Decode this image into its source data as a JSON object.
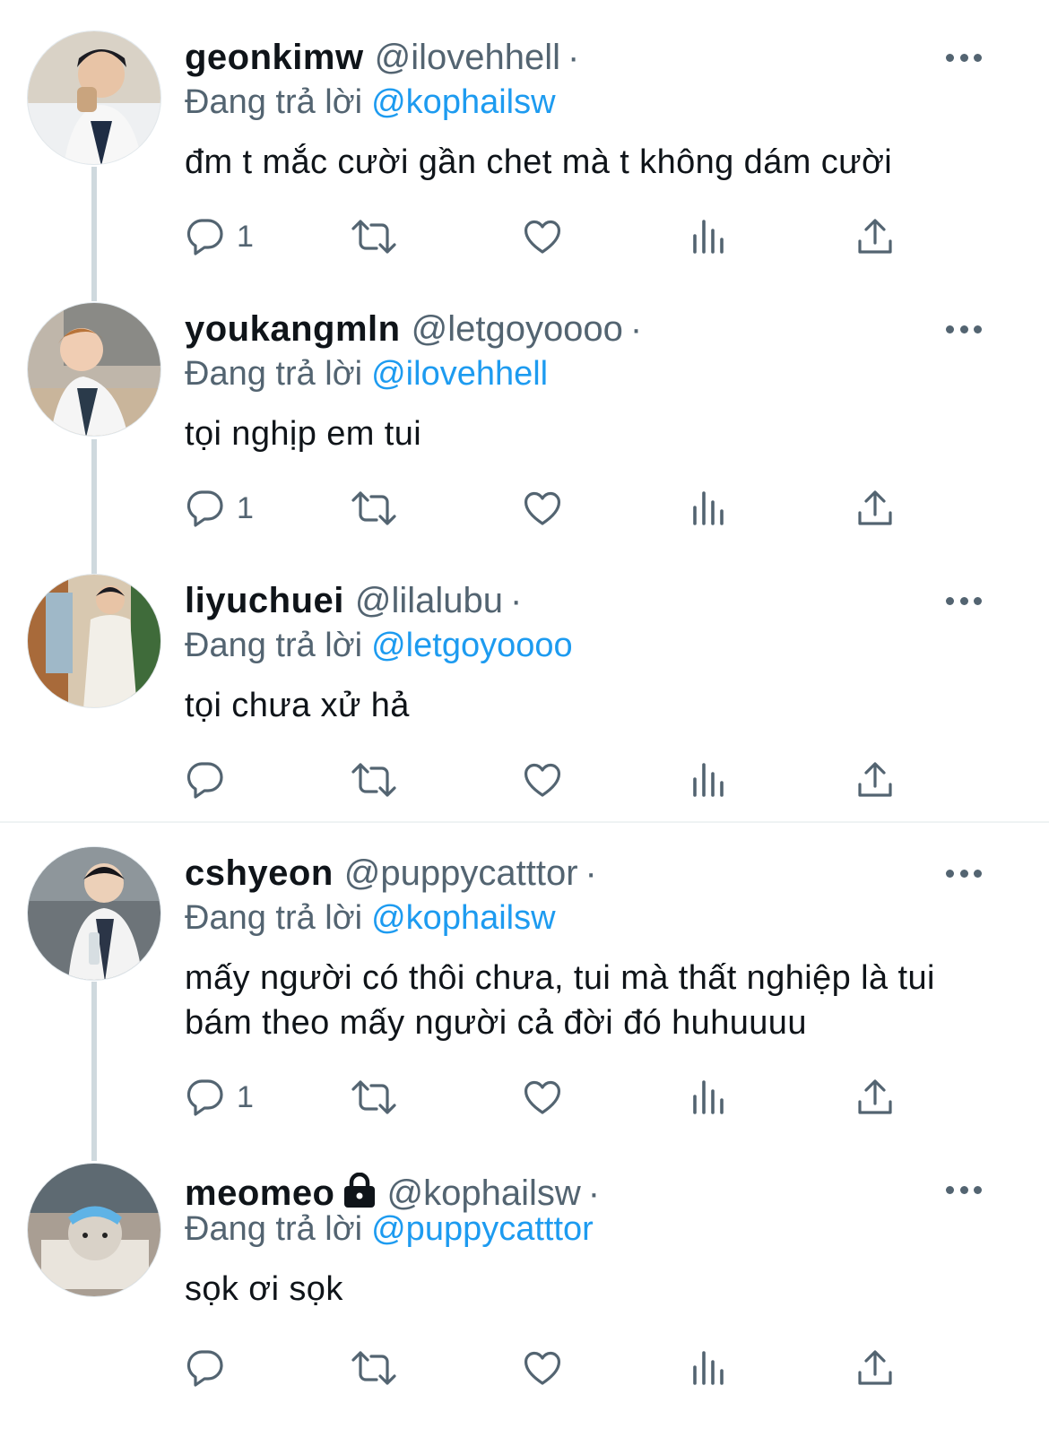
{
  "tweets": [
    {
      "name": "geonkimw",
      "handle": "@ilovehhell",
      "separator": "·",
      "reply_prefix": "Đang trả lời",
      "reply_to": "@kophailsw",
      "text": "đm t mắc cười gần chet mà t không dám cười",
      "reply_count": "1",
      "locked": false
    },
    {
      "name": "youkangmln",
      "handle": "@letgoyoooo",
      "separator": "·",
      "reply_prefix": "Đang trả lời",
      "reply_to": "@ilovehhell",
      "text": "tọi nghịp em tui",
      "reply_count": "1",
      "locked": false
    },
    {
      "name": "liyuchuei",
      "handle": "@lilalubu",
      "separator": "·",
      "reply_prefix": "Đang trả lời",
      "reply_to": "@letgoyoooo",
      "text": "tọi chưa xử hả",
      "reply_count": "",
      "locked": false
    },
    {
      "name": "cshyeon",
      "handle": "@puppycatttor",
      "separator": "·",
      "reply_prefix": "Đang trả lời",
      "reply_to": "@kophailsw",
      "text": "mấy người có thôi chưa, tui mà thất nghiệp là tui bám theo mấy người cả đời đó huhuuuu",
      "reply_count": "1",
      "locked": false
    },
    {
      "name": "meomeo",
      "handle": "@kophailsw",
      "separator": "·",
      "reply_prefix": "Đang trả lời",
      "reply_to": "@puppycatttor",
      "text": "sọk ơi sọk",
      "reply_count": "",
      "locked": true
    }
  ],
  "icons": [
    "reply-icon",
    "retweet-icon",
    "like-icon",
    "views-icon",
    "share-icon",
    "more-icon",
    "lock-icon"
  ],
  "colors": {
    "accent": "#1d9bf0",
    "secondary_text": "#536471",
    "thread_line": "#cfd9de"
  }
}
